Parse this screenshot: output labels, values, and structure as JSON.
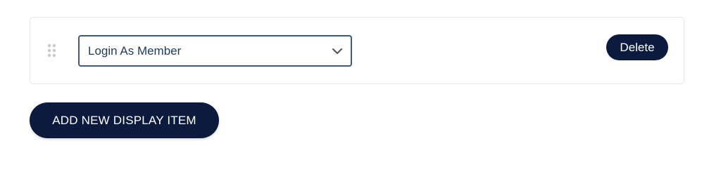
{
  "display_item": {
    "select": {
      "selected_value": "Login As Member"
    },
    "delete_label": "Delete",
    "drag_handle_icon": "drag-dots-icon",
    "dropdown_icon": "chevron-down-icon"
  },
  "actions": {
    "add_label": "ADD NEW DISPLAY ITEM"
  },
  "colors": {
    "primary_button": "#0b1a3d",
    "select_border": "#3d5a80",
    "select_text": "#1e3a5f",
    "card_border": "#e4e6ea",
    "handle_dots": "#c8cacd"
  }
}
